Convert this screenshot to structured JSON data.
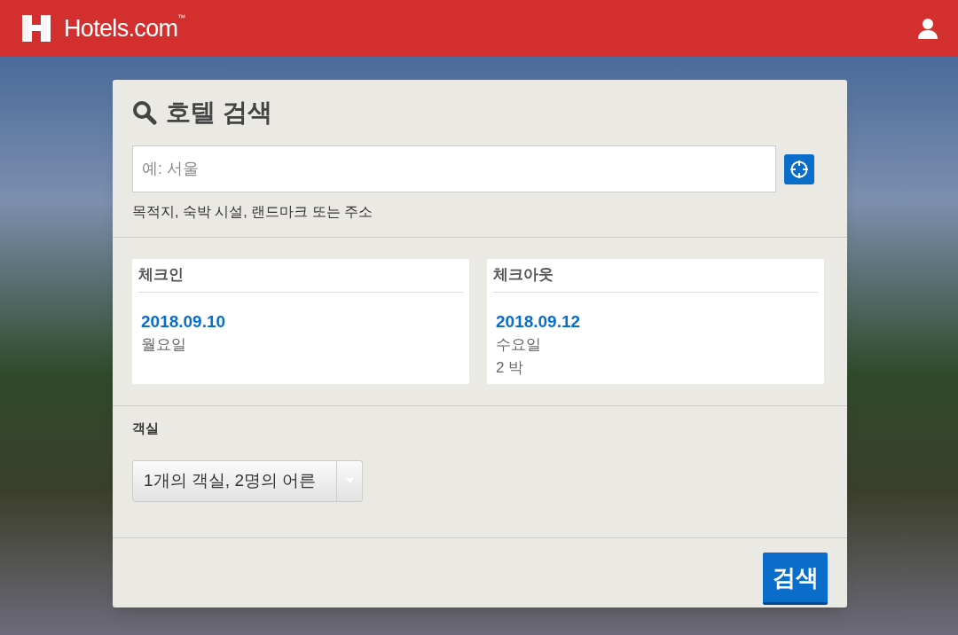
{
  "header": {
    "logo": "Hotels.com",
    "trademark": "™"
  },
  "search_panel": {
    "title": "호텔 검색",
    "destination": {
      "placeholder": "예: 서울",
      "hint": "목적지, 숙박 시설, 랜드마크 또는 주소"
    },
    "dates": [
      {
        "label": "체크인",
        "date": "2018.09.10",
        "weekday": "월요일"
      },
      {
        "label": "체크아웃",
        "date": "2018.09.12",
        "weekday": "수요일",
        "nights": "2 박"
      }
    ],
    "rooms": {
      "label": "객실",
      "value": "1개의 객실, 2명의 어른"
    },
    "search_button": "검색"
  }
}
